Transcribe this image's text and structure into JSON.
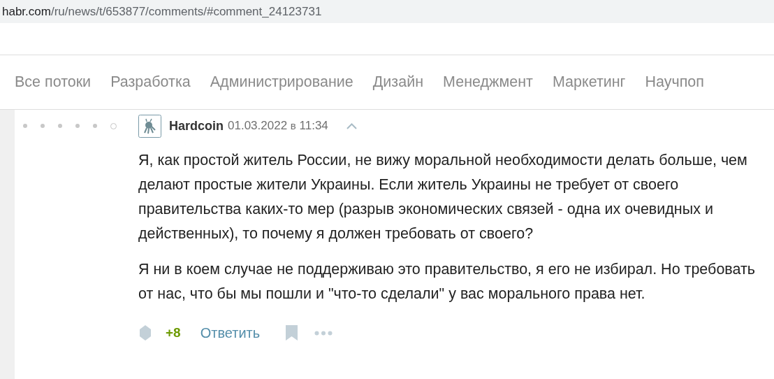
{
  "address_bar": {
    "domain": "habr.com",
    "path": "/ru/news/t/653877/comments/#comment_24123731"
  },
  "nav": {
    "items": [
      {
        "label": "Все потоки"
      },
      {
        "label": "Разработка"
      },
      {
        "label": "Администрирование"
      },
      {
        "label": "Дизайн"
      },
      {
        "label": "Менеджмент"
      },
      {
        "label": "Маркетинг"
      },
      {
        "label": "Научпоп"
      }
    ]
  },
  "comment": {
    "thread_dots": [
      {
        "current": false
      },
      {
        "current": false
      },
      {
        "current": false
      },
      {
        "current": false
      },
      {
        "current": false
      },
      {
        "current": true
      }
    ],
    "author": "Hardcoin",
    "date": "01.03.2022",
    "at": "в",
    "time": "11:34",
    "paragraphs": [
      "Я, как простой житель России, не вижу моральной необходимости делать больше, чем делают простые жители Украины. Если житель Украины не требует от своего правительства каких-то мер (разрыв экономических связей - одна их очевидных и действенных), то почему я должен требовать от своего?",
      "Я ни в коем случае не поддерживаю это правительство, я его не избирал. Но требовать от нас, что бы мы пошли и \"что-то сделали\" у вас морального права нет."
    ],
    "score": "+8",
    "reply": "Ответить"
  }
}
